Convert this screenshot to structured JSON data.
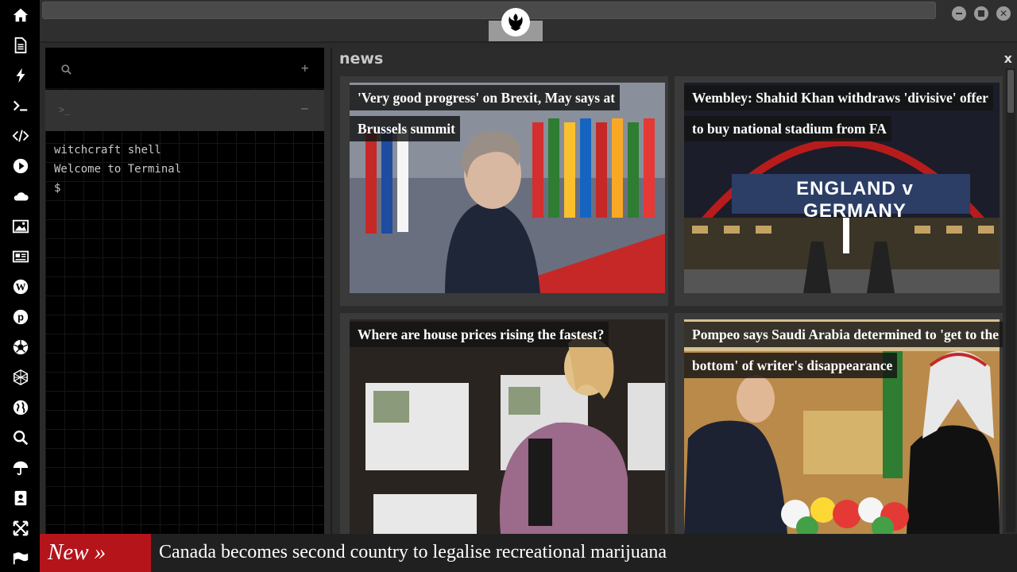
{
  "rail": {
    "icons": [
      "home-icon",
      "document-icon",
      "lightning-icon",
      "terminal-icon",
      "code-icon",
      "play-icon",
      "cloud-icon",
      "image-icon",
      "newspaper-icon",
      "wordpress-icon",
      "pinterest-icon",
      "aperture-icon",
      "globe-wireframe-icon",
      "earth-icon",
      "search-icon",
      "umbrella-icon",
      "contacts-icon",
      "fullscreen-icon",
      "flag-icon"
    ]
  },
  "terminal": {
    "search_icon": "search-icon",
    "add_label": "+",
    "tab_prompt": ">_",
    "tab_minimize": "–",
    "lines": [
      "witchcraft shell",
      "Welcome to Terminal",
      "$"
    ]
  },
  "news": {
    "title": "news",
    "close_label": "x",
    "cards": [
      {
        "headline": "'Very good progress' on Brexit, May says at Brussels summit"
      },
      {
        "headline": "Wembley: Shahid Khan withdraws 'divisive' offer to buy national stadium from FA",
        "photo_text": "ENGLAND v GERMANY"
      },
      {
        "headline": "Where are house prices rising the fastest?"
      },
      {
        "headline": "Pompeo says Saudi Arabia determined to 'get to the bottom' of writer's disappearance"
      }
    ]
  },
  "ticker": {
    "label": "New »",
    "text": "Canada becomes second country to legalise recreational marijuana"
  },
  "colors": {
    "accent_red": "#b5141b",
    "rail_bg": "#000000",
    "panel_bg": "#2c2c2c"
  }
}
